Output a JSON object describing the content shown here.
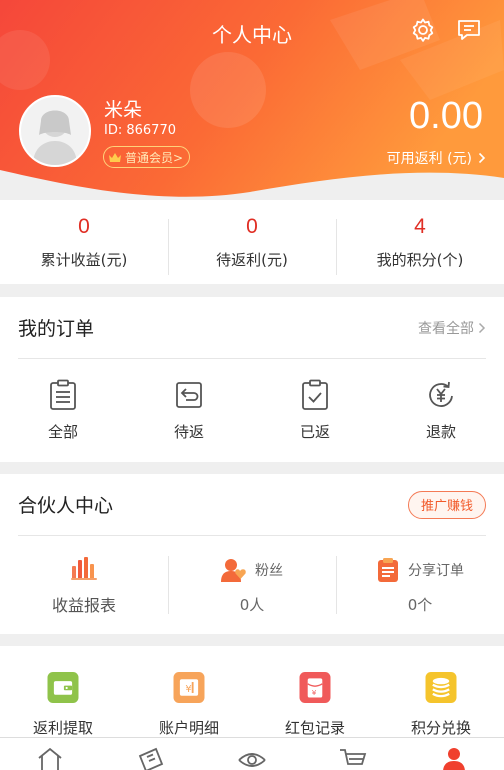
{
  "header": {
    "title": "个人中心",
    "settings_icon": "gear-icon",
    "message_icon": "message-icon"
  },
  "user": {
    "name": "米朵",
    "id_text": "ID: 866770",
    "member_label": "普通会员>",
    "avatar_icon": "avatar-placeholder"
  },
  "rebate": {
    "amount": "0.00",
    "label": "可用返利 (元)"
  },
  "stats": [
    {
      "value": "0",
      "label": "累计收益(元)"
    },
    {
      "value": "0",
      "label": "待返利(元)"
    },
    {
      "value": "4",
      "label": "我的积分(个)"
    }
  ],
  "orders": {
    "title": "我的订单",
    "view_all": "查看全部",
    "items": [
      {
        "label": "全部",
        "icon": "clipboard-list-icon"
      },
      {
        "label": "待返",
        "icon": "return-arrow-icon"
      },
      {
        "label": "已返",
        "icon": "clipboard-check-icon"
      },
      {
        "label": "退款",
        "icon": "yen-refund-icon"
      }
    ]
  },
  "partner": {
    "title": "合伙人中心",
    "promo_button": "推广赚钱",
    "items": [
      {
        "label": "收益报表",
        "sub": "",
        "icon": "bar-chart-icon"
      },
      {
        "label": "粉丝",
        "sub": "0人",
        "icon": "fans-icon"
      },
      {
        "label": "分享订单",
        "sub": "0个",
        "icon": "share-order-icon"
      }
    ]
  },
  "tools": [
    {
      "label": "返利提取",
      "icon": "wallet-icon",
      "color": "#8fc34a"
    },
    {
      "label": "账户明细",
      "icon": "account-detail-icon",
      "color": "#f7a45a"
    },
    {
      "label": "红包记录",
      "icon": "red-packet-icon",
      "color": "#f05a5a"
    },
    {
      "label": "积分兑换",
      "icon": "coins-icon",
      "color": "#f5c42c"
    }
  ],
  "tabbar": [
    {
      "name": "home",
      "icon": "home-icon"
    },
    {
      "name": "coupon",
      "icon": "ticket-icon"
    },
    {
      "name": "discover",
      "icon": "eye-icon"
    },
    {
      "name": "cart",
      "icon": "cart-icon"
    },
    {
      "name": "profile",
      "icon": "user-icon"
    }
  ],
  "colors": {
    "accent": "#f53d2d",
    "header_start": "#f5533c",
    "header_end": "#ff9a3c",
    "stat_value": "#e02e24",
    "active_tab": "#f0402e"
  }
}
